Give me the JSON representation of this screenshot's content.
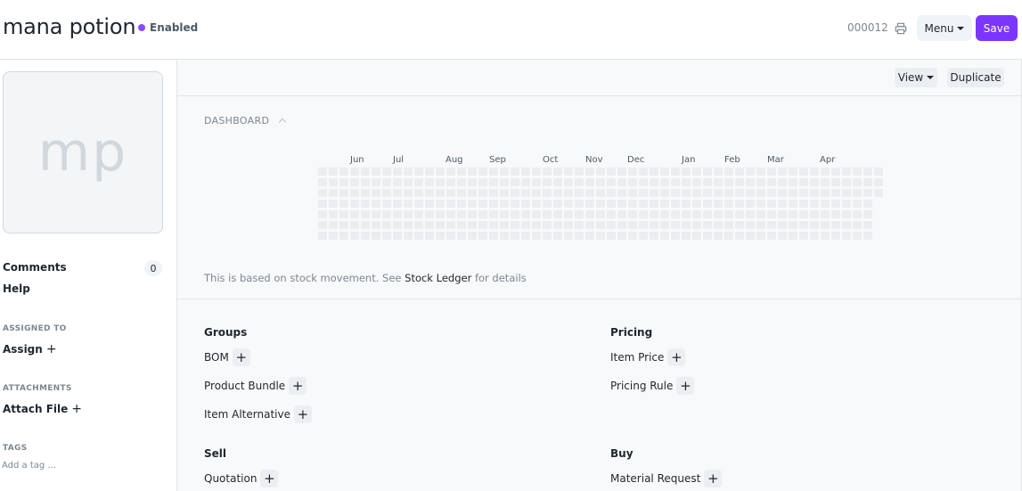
{
  "header": {
    "title": "mana potion",
    "status": "Enabled",
    "doc_id": "000012",
    "menu_label": "Menu",
    "save_label": "Save",
    "accent_color": "#7c35ff"
  },
  "sidebar": {
    "avatar_initials": "mp",
    "comments_label": "Comments",
    "comments_count": "0",
    "help_label": "Help",
    "assigned_caption": "ASSIGNED TO",
    "assign_label": "Assign",
    "attachments_caption": "ATTACHMENTS",
    "attach_label": "Attach File",
    "tags_caption": "TAGS",
    "tag_placeholder": "Add a tag ..."
  },
  "toolbar": {
    "view_label": "View",
    "duplicate_label": "Duplicate"
  },
  "dashboard": {
    "label": "DASHBOARD",
    "months": [
      "Jun",
      "Jul",
      "Aug",
      "Sep",
      "Oct",
      "Nov",
      "Dec",
      "Jan",
      "Feb",
      "Mar",
      "Apr"
    ],
    "note_prefix": "This is based on stock movement. See ",
    "note_link": "Stock Ledger",
    "note_suffix": " for details"
  },
  "connections": {
    "groups": {
      "title": "Groups",
      "items": [
        "BOM",
        "Product Bundle",
        "Item Alternative"
      ]
    },
    "pricing": {
      "title": "Pricing",
      "items": [
        "Item Price",
        "Pricing Rule"
      ]
    },
    "sell": {
      "title": "Sell",
      "items": [
        "Quotation"
      ]
    },
    "buy": {
      "title": "Buy",
      "items": [
        "Material Request"
      ]
    }
  }
}
